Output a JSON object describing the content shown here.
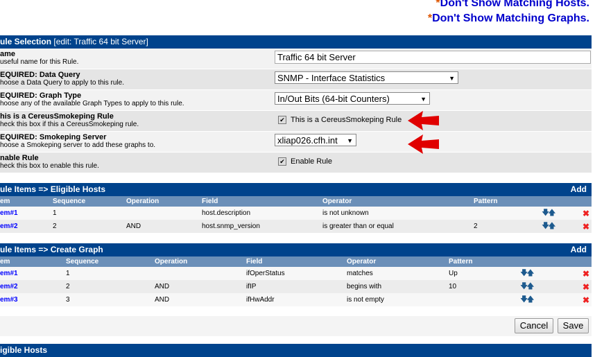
{
  "top_links": {
    "hosts": "Don't Show Matching Hosts.",
    "graphs": "Don't Show Matching Graphs.",
    "star": "*"
  },
  "rule_selection": {
    "title": "ule Selection",
    "edit": "[edit: Traffic 64 bit Server]",
    "fields": [
      {
        "label": "ame",
        "desc": "useful name for this Rule.",
        "value": "Traffic 64 bit Server"
      },
      {
        "label": "EQUIRED: Data Query",
        "desc": "hoose a Data Query to apply to this rule.",
        "value": "SNMP - Interface Statistics"
      },
      {
        "label": "EQUIRED: Graph Type",
        "desc": "hoose any of the available Graph Types to apply to this rule.",
        "value": "In/Out Bits (64-bit Counters)"
      },
      {
        "label": "his is a CereusSmokeping Rule",
        "desc": "heck this box if this a CereusSmokeping rule.",
        "value": "This is a CereusSmokeping Rule"
      },
      {
        "label": "EQUIRED: Smokeping Server",
        "desc": "hoose a Smokeping server to add these graphs to.",
        "value": "xliap026.cfh.int"
      },
      {
        "label": "nable Rule",
        "desc": "heck this box to enable this rule.",
        "value": "Enable Rule"
      }
    ]
  },
  "eligible_hosts": {
    "title": "ule Items => Eligible Hosts",
    "add": "Add",
    "columns": [
      "em",
      "Sequence",
      "Operation",
      "Field",
      "Operator",
      "Pattern"
    ],
    "rows": [
      {
        "item": "em#1",
        "seq": "1",
        "op": "",
        "field": "host.description",
        "operator": "is not unknown",
        "pattern": ""
      },
      {
        "item": "em#2",
        "seq": "2",
        "op": "AND",
        "field": "host.snmp_version",
        "operator": "is greater than or equal",
        "pattern": "2"
      }
    ]
  },
  "create_graph": {
    "title": "ule Items => Create Graph",
    "add": "Add",
    "columns": [
      "em",
      "Sequence",
      "Operation",
      "Field",
      "Operator",
      "Pattern"
    ],
    "rows": [
      {
        "item": "em#1",
        "seq": "1",
        "op": "",
        "field": "ifOperStatus",
        "operator": "matches",
        "pattern": "Up"
      },
      {
        "item": "em#2",
        "seq": "2",
        "op": "AND",
        "field": "ifIP",
        "operator": "begins with",
        "pattern": "10"
      },
      {
        "item": "em#3",
        "seq": "3",
        "op": "AND",
        "field": "ifHwAddr",
        "operator": "is not empty",
        "pattern": ""
      }
    ]
  },
  "buttons": {
    "cancel": "Cancel",
    "save": "Save"
  },
  "bottom": {
    "title": "igible Hosts"
  },
  "icons": {
    "move": "up-down-arrows-icon",
    "delete": "delete-x-icon"
  },
  "colors": {
    "header": "#00438c",
    "subheader": "#6b8fb8",
    "link": "#0000ff",
    "delete": "#ee2222",
    "annotation_arrow": "#e00000"
  }
}
